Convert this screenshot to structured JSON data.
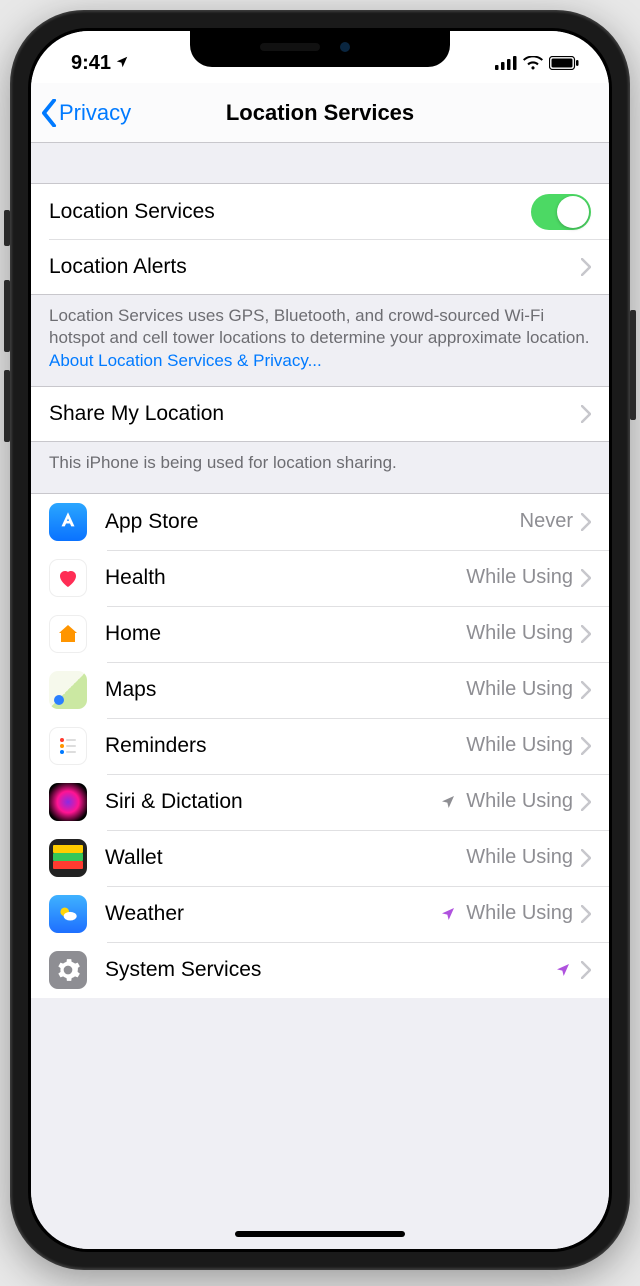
{
  "status": {
    "time": "9:41"
  },
  "nav": {
    "back_label": "Privacy",
    "title": "Location Services"
  },
  "section1": {
    "location_services_label": "Location Services",
    "location_alerts_label": "Location Alerts",
    "footer_text": "Location Services uses GPS, Bluetooth, and crowd-sourced Wi-Fi hotspot and cell tower locations to determine your approximate location. ",
    "footer_link": "About Location Services & Privacy..."
  },
  "section2": {
    "share_label": "Share My Location",
    "footer_text": "This iPhone is being used for location sharing."
  },
  "apps": [
    {
      "name": "App Store",
      "value": "Never",
      "icon": "appstore",
      "arrow": "none"
    },
    {
      "name": "Health",
      "value": "While Using",
      "icon": "health",
      "arrow": "none"
    },
    {
      "name": "Home",
      "value": "While Using",
      "icon": "home",
      "arrow": "none"
    },
    {
      "name": "Maps",
      "value": "While Using",
      "icon": "maps",
      "arrow": "none"
    },
    {
      "name": "Reminders",
      "value": "While Using",
      "icon": "reminders",
      "arrow": "none"
    },
    {
      "name": "Siri & Dictation",
      "value": "While Using",
      "icon": "siri",
      "arrow": "gray"
    },
    {
      "name": "Wallet",
      "value": "While Using",
      "icon": "wallet",
      "arrow": "none"
    },
    {
      "name": "Weather",
      "value": "While Using",
      "icon": "weather",
      "arrow": "purple"
    },
    {
      "name": "System Services",
      "value": "",
      "icon": "system",
      "arrow": "purple"
    }
  ]
}
